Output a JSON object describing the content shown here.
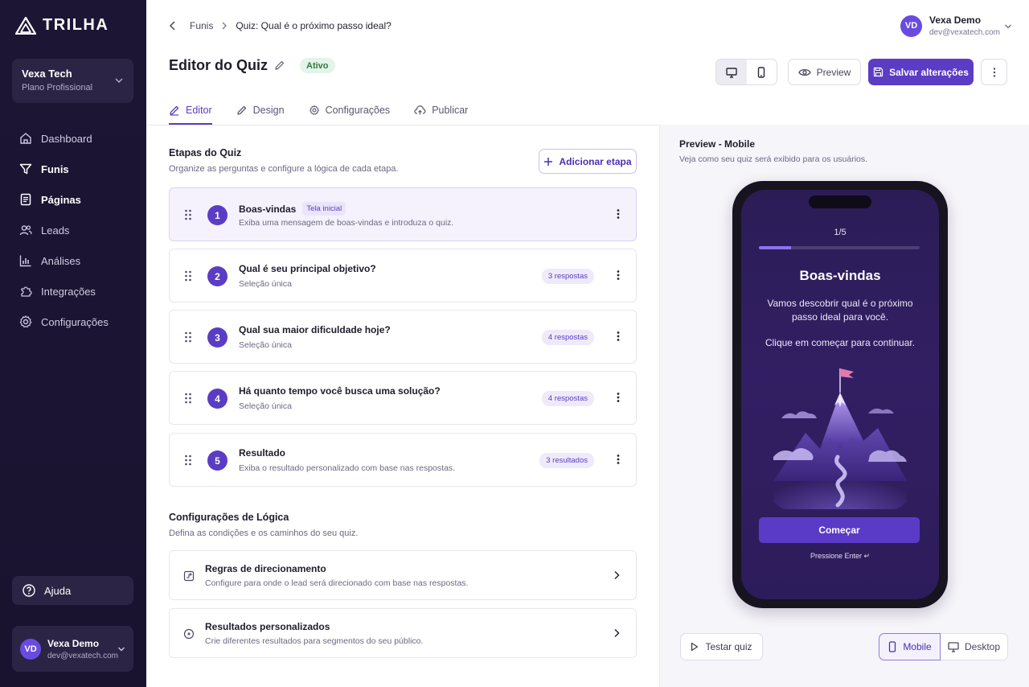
{
  "brand": {
    "name": "TRILHA"
  },
  "workspace": {
    "name": "Vexa Tech",
    "plan": "Plano Profissional"
  },
  "nav": {
    "items": [
      {
        "label": "Dashboard",
        "icon": "home-icon"
      },
      {
        "label": "Funis",
        "icon": "funnel-icon"
      },
      {
        "label": "Páginas",
        "icon": "page-icon"
      },
      {
        "label": "Leads",
        "icon": "users-icon"
      },
      {
        "label": "Análises",
        "icon": "chart-icon"
      },
      {
        "label": "Integrações",
        "icon": "puzzle-icon"
      },
      {
        "label": "Configurações",
        "icon": "gear-icon"
      }
    ],
    "active": "Funis"
  },
  "help": {
    "label": "Ajuda"
  },
  "user": {
    "initials": "VD",
    "name": "Vexa Demo",
    "email": "dev@vexatech.com"
  },
  "breadcrumb": {
    "parent": "Funis",
    "current_prefix": "Quiz: Qual é o próximo ",
    "current_bold": "passo ideal?"
  },
  "header": {
    "title": "Editor do Quiz",
    "status": "Ativo",
    "preview_label": "Preview",
    "save_label": "Salvar alterações"
  },
  "tabs": [
    {
      "label": "Editor",
      "active": true
    },
    {
      "label": "Design"
    },
    {
      "label": "Configurações"
    },
    {
      "label": "Publicar"
    }
  ],
  "steps_section": {
    "title": "Etapas do Quiz",
    "subtitle": "Organize as perguntas e configure a lógica de cada etapa.",
    "add_label": "Adicionar etapa",
    "steps": [
      {
        "n": "1",
        "title": "Boas-vindas",
        "tag": "Tela inicial",
        "subtitle": "Exiba uma mensagem de boas-vindas e introduza o quiz.",
        "count": ""
      },
      {
        "n": "2",
        "title": "Qual é seu principal objetivo?",
        "subtitle": "Seleção única",
        "count": "3 respostas"
      },
      {
        "n": "3",
        "title": "Qual sua maior dificuldade hoje?",
        "subtitle": "Seleção única",
        "count": "4 respostas"
      },
      {
        "n": "4",
        "title": "Há quanto tempo você busca uma solução?",
        "subtitle": "Seleção única",
        "count": "4 respostas"
      },
      {
        "n": "5",
        "title": "Resultado",
        "subtitle": "Exiba o resultado personalizado com base nas respostas.",
        "count": "3 resultados"
      }
    ]
  },
  "logic_section": {
    "title": "Configurações de Lógica",
    "subtitle": "Defina as condições e os caminhos do seu quiz.",
    "items": [
      {
        "title": "Regras de direcionamento",
        "subtitle": "Configure para onde o lead será direcionado com base nas respostas."
      },
      {
        "title": "Resultados personalizados",
        "subtitle": "Crie diferentes resultados para segmentos do seu público."
      }
    ]
  },
  "preview": {
    "title": "Preview - Mobile",
    "subtitle": "Veja como seu quiz será exibido para os usuários.",
    "phone": {
      "progress_text": "1/5",
      "progress": 0.2,
      "heading": "Boas-vindas",
      "body": "Vamos descobrir qual é o próximo passo ideal para você.",
      "body2": "Clique em começar para continuar.",
      "button": "Começar",
      "hint": "Pressione Enter ↵"
    },
    "test_label": "Testar quiz",
    "mobile_label": "Mobile",
    "desktop_label": "Desktop"
  },
  "colors": {
    "accent": "#5b3cc4",
    "sidebar": "#1c1534",
    "success": "#2f7a45"
  }
}
